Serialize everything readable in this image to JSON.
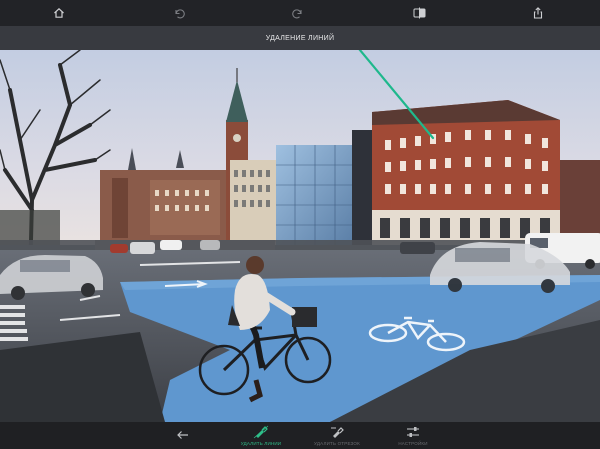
{
  "toolbar": {
    "home_icon": "home-icon",
    "undo_icon": "undo-icon",
    "redo_icon": "redo-icon",
    "compare_icon": "compare-icon",
    "share_icon": "share-icon"
  },
  "subtitle": "УДАЛЕНИЕ ЛИНИЙ",
  "bottom": {
    "back_icon": "back-arrow-icon",
    "tools": [
      {
        "label": "УДАЛИТЬ ЛИНИИ",
        "icon": "brush-line-icon",
        "active": true
      },
      {
        "label": "УДАЛИТЬ ОТРЕЗОК",
        "icon": "brush-segment-icon",
        "active": false
      },
      {
        "label": "НАСТРОЙКИ",
        "icon": "sliders-icon",
        "active": false
      }
    ]
  },
  "colors": {
    "accent": "#2fbf8a",
    "stroke_line": "#1fb88c",
    "bike_lane": "#5f97cf"
  }
}
